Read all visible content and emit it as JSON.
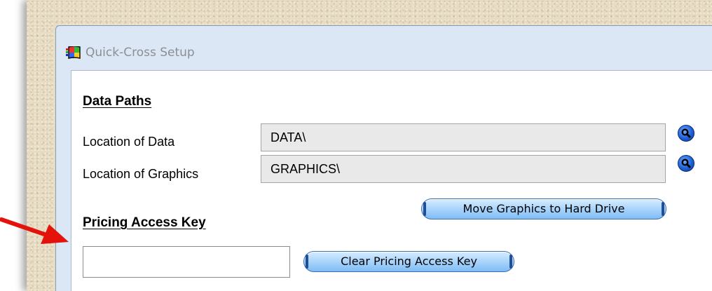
{
  "window": {
    "title": "Quick-Cross Setup"
  },
  "data_paths": {
    "heading": "Data Paths",
    "location_of_data_label": "Location of Data",
    "location_of_data_value": "DATA\\",
    "location_of_graphics_label": "Location of Graphics",
    "location_of_graphics_value": "GRAPHICS\\",
    "browse_icon": "magnifier-icon",
    "move_graphics_button": "Move Graphics to Hard Drive"
  },
  "pricing": {
    "heading": "Pricing Access Key",
    "key_value": "",
    "clear_button": "Clear Pricing Access Key"
  },
  "annotation": {
    "arrow_color": "#e3120b"
  }
}
